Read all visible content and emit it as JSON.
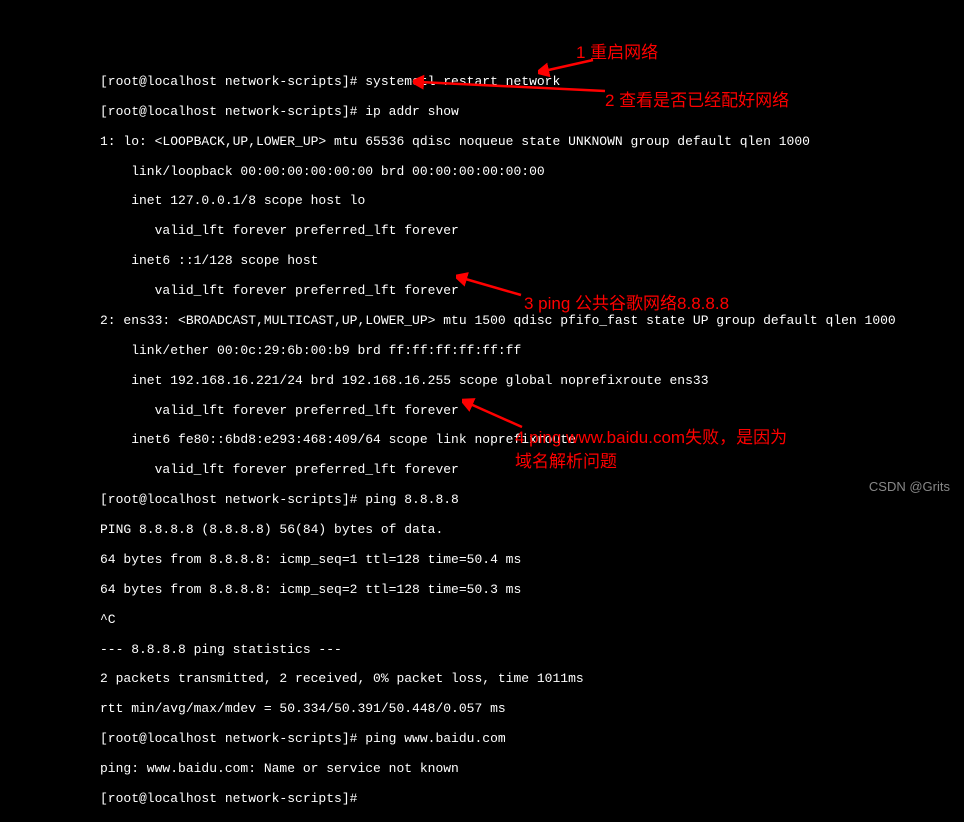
{
  "terminal": {
    "lines": [
      "[root@localhost network-scripts]# systemctl restart network",
      "[root@localhost network-scripts]# ip addr show",
      "1: lo: <LOOPBACK,UP,LOWER_UP> mtu 65536 qdisc noqueue state UNKNOWN group default qlen 1000",
      "    link/loopback 00:00:00:00:00:00 brd 00:00:00:00:00:00",
      "    inet 127.0.0.1/8 scope host lo",
      "       valid_lft forever preferred_lft forever",
      "    inet6 ::1/128 scope host",
      "       valid_lft forever preferred_lft forever",
      "2: ens33: <BROADCAST,MULTICAST,UP,LOWER_UP> mtu 1500 qdisc pfifo_fast state UP group default qlen 1000",
      "    link/ether 00:0c:29:6b:00:b9 brd ff:ff:ff:ff:ff:ff",
      "    inet 192.168.16.221/24 brd 192.168.16.255 scope global noprefixroute ens33",
      "       valid_lft forever preferred_lft forever",
      "    inet6 fe80::6bd8:e293:468:409/64 scope link noprefixroute",
      "       valid_lft forever preferred_lft forever",
      "[root@localhost network-scripts]# ping 8.8.8.8",
      "PING 8.8.8.8 (8.8.8.8) 56(84) bytes of data.",
      "64 bytes from 8.8.8.8: icmp_seq=1 ttl=128 time=50.4 ms",
      "64 bytes from 8.8.8.8: icmp_seq=2 ttl=128 time=50.3 ms",
      "^C",
      "--- 8.8.8.8 ping statistics ---",
      "2 packets transmitted, 2 received, 0% packet loss, time 1011ms",
      "rtt min/avg/max/mdev = 50.334/50.391/50.448/0.057 ms",
      "[root@localhost network-scripts]# ping www.baidu.com",
      "ping: www.baidu.com: Name or service not known",
      "[root@localhost network-scripts]# "
    ]
  },
  "annotations": {
    "a1": "1 重启网络",
    "a2": "2 查看是否已经配好网络",
    "a3": "3 ping 公共谷歌网络8.8.8.8",
    "a4_line1": "4 ping www.baidu.com失败，是因为",
    "a4_line2": "域名解析问题"
  },
  "watermark": "CSDN @Grits"
}
